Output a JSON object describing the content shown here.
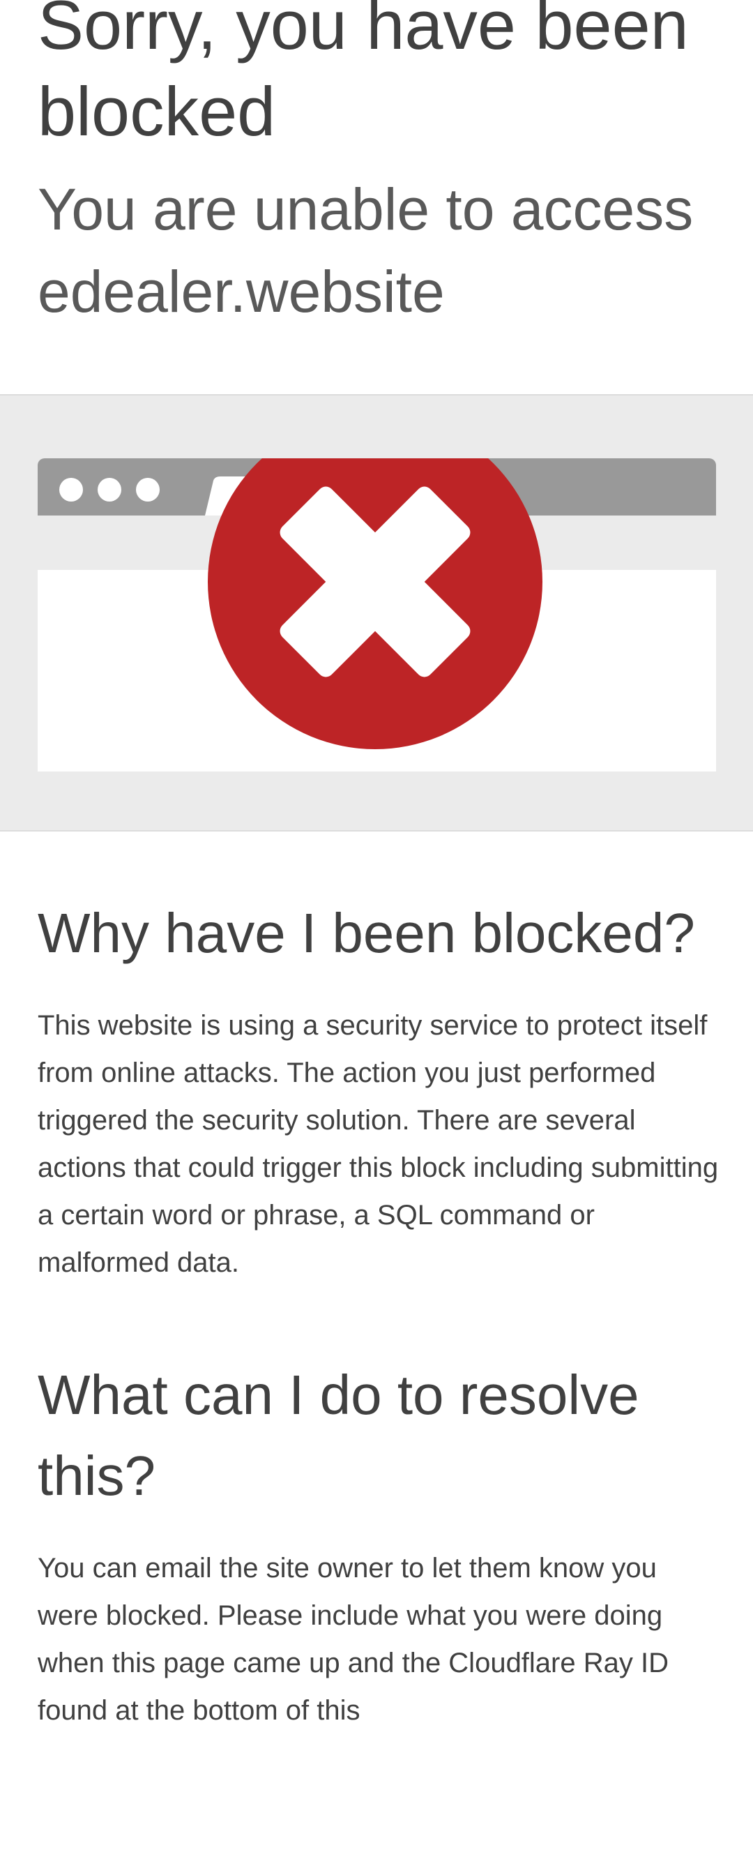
{
  "header": {
    "title": "Sorry, you have been blocked",
    "subtitle": "You are unable to access edealer.website"
  },
  "illustration": {
    "icon": "error-x-icon",
    "colors": {
      "band_background": "#ebebeb",
      "browser_bar": "#999999",
      "browser_body": "#ffffff",
      "error_circle": "#bd2426",
      "error_cross": "#ffffff"
    }
  },
  "sections": [
    {
      "heading": "Why have I been blocked?",
      "text": "This website is using a security service to protect itself from online attacks. The action you just performed triggered the security solution. There are several actions that could trigger this block including submitting a certain word or phrase, a SQL command or malformed data."
    },
    {
      "heading": "What can I do to resolve this?",
      "text": "You can email the site owner to let them know you were blocked. Please include what you were doing when this page came up and the Cloudflare Ray ID found at the bottom of this"
    }
  ]
}
